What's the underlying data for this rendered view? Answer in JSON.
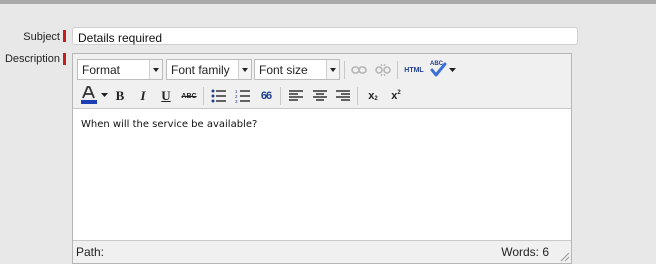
{
  "form": {
    "subject_label": "Subject",
    "subject_value": "Details required",
    "description_label": "Description"
  },
  "editor": {
    "format_label": "Format",
    "font_family_label": "Font family",
    "font_size_label": "Font size",
    "html_label": "HTML",
    "spellcheck_label": "ABC",
    "bold_label": "B",
    "italic_label": "I",
    "underline_label": "U",
    "strikethrough_label": "ABC",
    "blockquote_label": "66",
    "subscript_label": "x",
    "superscript_label": "x",
    "content_text": "When will the service be available?",
    "path_label": "Path:",
    "words_label": "Words: 6"
  },
  "colors": {
    "required_marker": "#c81d1d",
    "text_color_bar": "#1d3fb5"
  }
}
